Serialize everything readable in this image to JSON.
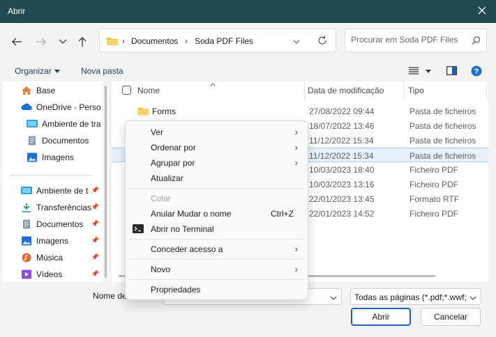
{
  "window": {
    "title": "Abrir"
  },
  "address": {
    "crumbs": [
      "Documentos",
      "Soda PDF Files"
    ],
    "separator": "›"
  },
  "search": {
    "placeholder": "Procurar em Soda PDF Files"
  },
  "commandbar": {
    "organize": "Organizar",
    "new_folder": "Nova pasta"
  },
  "sidebar": {
    "items": [
      {
        "label": "Base",
        "icon": "home-icon"
      },
      {
        "label": "OneDrive - Personal",
        "icon": "cloud-icon"
      },
      {
        "label": "Ambiente de trabalho",
        "icon": "desktop-icon"
      },
      {
        "label": "Documentos",
        "icon": "document-icon"
      },
      {
        "label": "Imagens",
        "icon": "image-icon"
      },
      {
        "label": "Ambiente de trabalho",
        "icon": "desktop-icon"
      },
      {
        "label": "Transferências",
        "icon": "download-icon"
      },
      {
        "label": "Documentos",
        "icon": "document-icon"
      },
      {
        "label": "Imagens",
        "icon": "image-icon"
      },
      {
        "label": "Música",
        "icon": "music-icon"
      },
      {
        "label": "Vídeos",
        "icon": "video-icon"
      }
    ]
  },
  "table": {
    "columns": [
      "Nome",
      "Data de modificação",
      "Tipo"
    ],
    "rows": [
      {
        "name": "Forms",
        "date": "27/08/2022 09:44",
        "type": "Pasta de ficheiros",
        "icon": "folder-icon"
      },
      {
        "name": "",
        "date": "18/07/2022 13:46",
        "type": "Pasta de ficheiros",
        "icon": ""
      },
      {
        "name": "",
        "date": "11/12/2022 15:34",
        "type": "Pasta de ficheiros",
        "icon": ""
      },
      {
        "name": "",
        "date": "11/12/2022 15:34",
        "type": "Pasta de ficheiros",
        "icon": ""
      },
      {
        "name": "",
        "date": "10/03/2023 18:40",
        "type": "Ficheiro PDF",
        "icon": ""
      },
      {
        "name": "",
        "date": "10/03/2023 13:16",
        "type": "Ficheiro PDF",
        "icon": ""
      },
      {
        "name": "",
        "date": "22/01/2023 13:45",
        "type": "Formato RTF",
        "icon": ""
      },
      {
        "name": "",
        "date": "22/01/2023 14:52",
        "type": "Ficheiro PDF",
        "icon": ""
      }
    ],
    "selected_row": 3
  },
  "bottom": {
    "filename_label": "Nome de",
    "filename_value": "",
    "filetype": "Todas as páginas (*.pdf;*.wwf;*.",
    "open_label": "Abrir",
    "cancel_label": "Cancelar"
  },
  "context_menu": {
    "items": [
      {
        "label": "Ver",
        "submenu": true
      },
      {
        "label": "Ordenar por",
        "submenu": true
      },
      {
        "label": "Agrupar por",
        "submenu": true
      },
      {
        "label": "Atualizar"
      },
      {
        "label": "Colar",
        "disabled": true
      },
      {
        "label": "Anular Mudar o nome",
        "shortcut": "Ctrl+Z"
      },
      {
        "label": "Abrir no Terminal",
        "icon": "terminal-icon"
      },
      {
        "label": "Conceder acesso a",
        "submenu": true
      },
      {
        "label": "Novo",
        "submenu": true
      },
      {
        "label": "Propriedades"
      }
    ]
  },
  "colors": {
    "titlebar": "#1f4a4f",
    "accent": "#1a5fb4",
    "folder": "#f4c542"
  }
}
